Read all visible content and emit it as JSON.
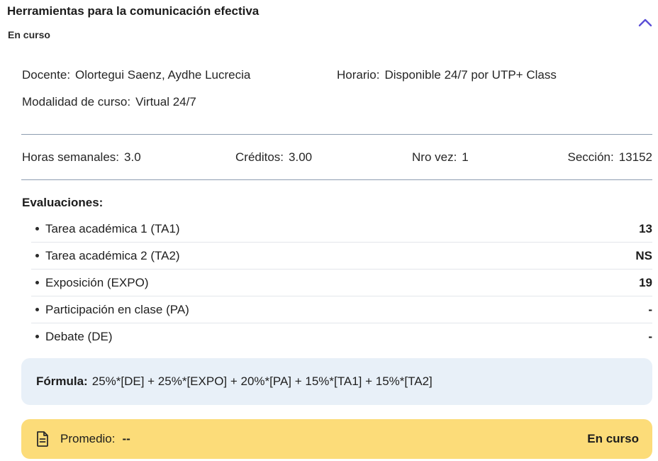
{
  "course": {
    "title": "Herramientas para la comunicación efectiva",
    "status": "En curso"
  },
  "info": {
    "teacher_label": "Docente:",
    "teacher": "Olortegui Saenz, Aydhe Lucrecia",
    "schedule_label": "Horario:",
    "schedule": "Disponible 24/7 por UTP+ Class",
    "modality_label": "Modalidad de curso:",
    "modality": "Virtual 24/7"
  },
  "stats": {
    "hours_label": "Horas semanales:",
    "hours": "3.0",
    "credits_label": "Créditos:",
    "credits": "3.00",
    "attempt_label": "Nro vez:",
    "attempt": "1",
    "section_label": "Sección:",
    "section": "13152"
  },
  "evaluations": {
    "title": "Evaluaciones:",
    "items": [
      {
        "name": "Tarea académica 1 (TA1)",
        "score": "13"
      },
      {
        "name": "Tarea académica 2 (TA2)",
        "score": "NS"
      },
      {
        "name": "Exposición (EXPO)",
        "score": "19"
      },
      {
        "name": "Participación en clase (PA)",
        "score": "-"
      },
      {
        "name": "Debate (DE)",
        "score": "-"
      }
    ]
  },
  "formula": {
    "label": "Fórmula:",
    "value": "25%*[DE] + 25%*[EXPO] + 20%*[PA] + 15%*[TA1] + 15%*[TA2]"
  },
  "average": {
    "label": "Promedio:",
    "value": "--",
    "status": "En curso",
    "icon": "document-icon"
  },
  "colors": {
    "accent": "#5b4fd6",
    "formula_bg": "#e8f0f8",
    "average_bg": "#fcdc79"
  }
}
